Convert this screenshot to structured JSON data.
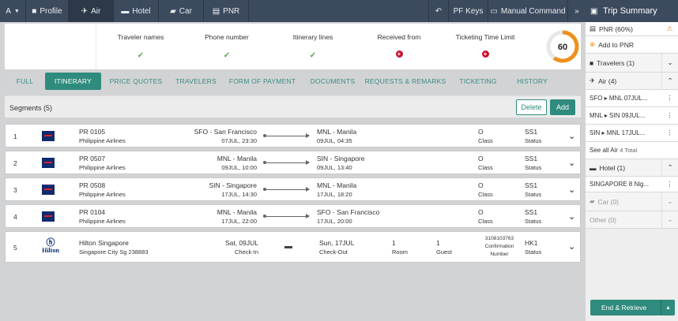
{
  "topbar": {
    "menu": "A",
    "tabs": [
      {
        "label": "Profile",
        "icon": "user-icon"
      },
      {
        "label": "Air",
        "icon": "plane-icon"
      },
      {
        "label": "Hotel",
        "icon": "bed-icon"
      },
      {
        "label": "Car",
        "icon": "car-icon"
      },
      {
        "label": "PNR",
        "icon": "list-icon"
      }
    ],
    "pf_keys": "PF Keys",
    "manual_command": "Manual Command",
    "expand": "»"
  },
  "summary": {
    "items": [
      {
        "label": "Traveler names",
        "status": "ok"
      },
      {
        "label": "Phone number",
        "status": "ok"
      },
      {
        "label": "Itinerary lines",
        "status": "ok"
      },
      {
        "label": "Received from",
        "status": "error"
      },
      {
        "label": "Ticketing Time Limit",
        "status": "error"
      }
    ],
    "score": "60",
    "score_fraction": 0.6,
    "accent": "#f0901e"
  },
  "tabs": [
    "FULL",
    "ITINERARY",
    "PRICE QUOTES",
    "TRAVELERS",
    "FORM OF PAYMENT",
    "DOCUMENTS",
    "REQUESTS & REMARKS",
    "TICKETING",
    "HISTORY"
  ],
  "segments": {
    "header": "Segments (5)",
    "delete": "Delete",
    "add": "Add",
    "flights": [
      {
        "n": "1",
        "flight": "PR 0105",
        "airline": "Philippine Airlines",
        "dep": "SFO - San Francisco",
        "dep_time": "07JUL, 23:30",
        "arr": "MNL - Manila",
        "arr_time": "09JUL, 04:35",
        "cls": "O",
        "cls_label": "Class",
        "status": "SS1",
        "status_label": "Status"
      },
      {
        "n": "2",
        "flight": "PR 0507",
        "airline": "Philippine Airlines",
        "dep": "MNL - Manila",
        "dep_time": "09JUL, 10:00",
        "arr": "SIN - Singapore",
        "arr_time": "09JUL, 13:40",
        "cls": "O",
        "cls_label": "Class",
        "status": "SS1",
        "status_label": "Status"
      },
      {
        "n": "3",
        "flight": "PR 0508",
        "airline": "Philippine Airlines",
        "dep": "SIN - Singapore",
        "dep_time": "17JUL, 14:30",
        "arr": "MNL - Manila",
        "arr_time": "17JUL, 18:20",
        "cls": "O",
        "cls_label": "Class",
        "status": "SS1",
        "status_label": "Status"
      },
      {
        "n": "4",
        "flight": "PR 0104",
        "airline": "Philippine Airlines",
        "dep": "MNL - Manila",
        "dep_time": "17JUL, 22:00",
        "arr": "SFO - San Francisco",
        "arr_time": "17JUL, 20:00",
        "cls": "O",
        "cls_label": "Class",
        "status": "SS1",
        "status_label": "Status"
      }
    ],
    "hotel": {
      "n": "5",
      "logo": "Hilton",
      "name": "Hilton Singapore",
      "addr": "Singapore City Sg 238883",
      "checkin": "Sat, 09JUL",
      "checkin_label": "Check-In",
      "checkout": "Sun, 17JUL",
      "checkout_label": "Check-Out",
      "rooms": "1",
      "rooms_label": "Room",
      "guests": "1",
      "guests_label": "Guest",
      "conf": "3108103763",
      "conf_label1": "Confirmation",
      "conf_label2": "Number",
      "status": "HK1",
      "status_label": "Status"
    }
  },
  "trip_summary": {
    "title": "Trip Summary",
    "pnr": "PNR (60%)",
    "add_to_pnr": "Add to PNR",
    "travelers": "Travelers (1)",
    "air": "Air (4)",
    "air_items": [
      "SFO ▸ MNL 07JUL...",
      "MNL ▸ SIN 09JUL...",
      "SIN ▸ MNL 17JUL..."
    ],
    "see_all": "See all Air",
    "see_all_total": "4 Total",
    "hotel": "Hotel (1)",
    "hotel_item": "SINGAPORE 8 Nig...",
    "car": "Car (0)",
    "other": "Other (0)",
    "end_retrieve": "End & Retrieve"
  }
}
